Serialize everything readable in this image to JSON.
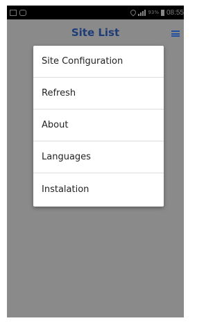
{
  "status_bar": {
    "battery_percent": "93%",
    "time": "08:55"
  },
  "app_bar": {
    "title": "Site List",
    "menu_icon": "hamburger-menu-icon"
  },
  "overflow_menu": {
    "items": [
      {
        "label": "Site Configuration"
      },
      {
        "label": "Refresh"
      },
      {
        "label": "About"
      },
      {
        "label": "Languages"
      },
      {
        "label": "Instalation"
      }
    ]
  },
  "colors": {
    "title": "#1e3c78",
    "menu_icon": "#1e4fa0",
    "background_dim": "#8a8a8a"
  }
}
